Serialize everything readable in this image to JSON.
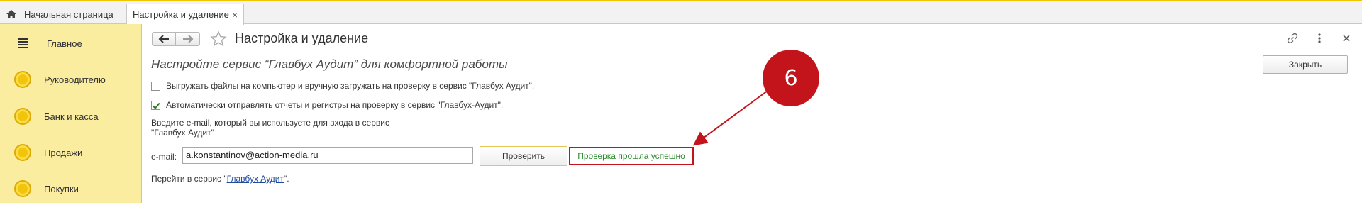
{
  "tabs": {
    "home_label": "Начальная страница",
    "active_label": "Настройка и удаление",
    "close_glyph": "×"
  },
  "sidebar": {
    "items": [
      {
        "label": "Главное",
        "icon": "menu-icon"
      },
      {
        "label": "Руководителю",
        "icon": "coin-icon"
      },
      {
        "label": "Банк и касса",
        "icon": "coin-icon"
      },
      {
        "label": "Продажи",
        "icon": "coin-icon"
      },
      {
        "label": "Покупки",
        "icon": "coin-icon"
      }
    ]
  },
  "form": {
    "title": "Настройка и удаление",
    "subtitle": "Настройте сервис “Главбух Аудит” для комфортной работы",
    "close_button": "Закрыть",
    "options": [
      {
        "label": "Выгружать файлы на компьютер и вручную загружать на проверку в сервис \"Главбух Аудит\".",
        "checked": false
      },
      {
        "label": "Автоматически отправлять отчеты и регистры на проверку в сервис \"Главбух-Аудит\".",
        "checked": true
      }
    ],
    "email_hint": "Введите e-mail, который вы используете для входа в сервис \"Главбух Аудит\"",
    "email_label": "e-mail:",
    "email_value": "a.konstantinov@action-media.ru",
    "check_button": "Проверить",
    "status_text": "Проверка прошла успешно",
    "goto_prefix": "Перейти в сервис \"",
    "goto_link": "Главбух Аудит",
    "goto_suffix": "\"."
  },
  "annotation": {
    "number": "6"
  },
  "colors": {
    "sidebar_bg": "#fbeda0",
    "tab_accent": "#f0c400",
    "highlight_red": "#c4141b",
    "success_green": "#2a8a2a",
    "link_blue": "#1f4b9e"
  }
}
